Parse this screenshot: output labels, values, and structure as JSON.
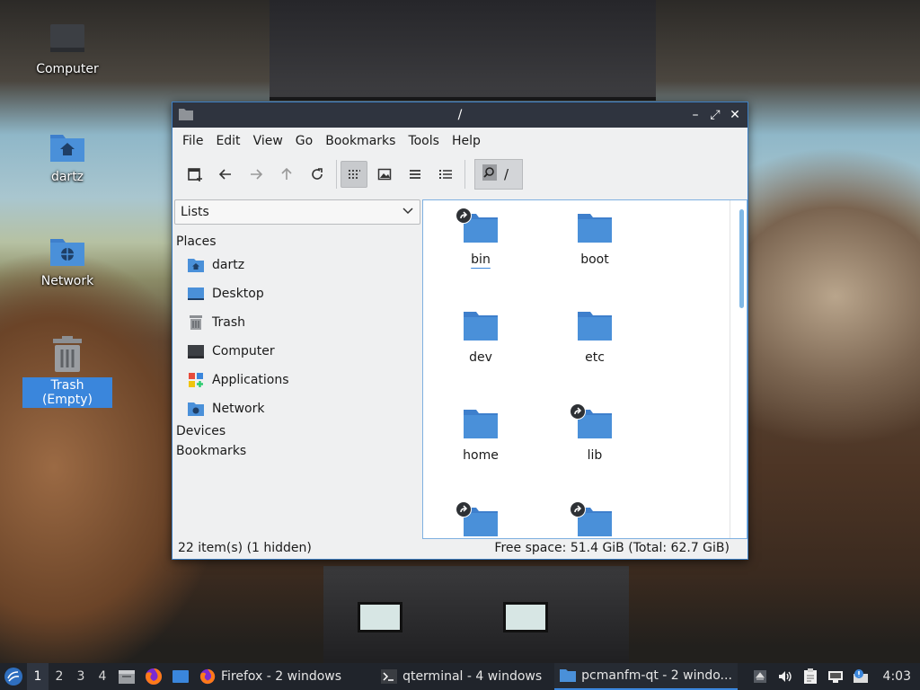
{
  "desktop": {
    "icons": [
      {
        "label": "Computer",
        "icon": "computer-icon"
      },
      {
        "label": "dartz",
        "icon": "home-folder-icon"
      },
      {
        "label": "Network",
        "icon": "network-folder-icon"
      },
      {
        "label": "Trash (Empty)",
        "icon": "trash-icon",
        "selected": true
      }
    ]
  },
  "window": {
    "title": "/",
    "buttons": {
      "minimize": "–",
      "maximize": "⤢",
      "close": "✕"
    },
    "menu": [
      "File",
      "Edit",
      "View",
      "Go",
      "Bookmarks",
      "Tools",
      "Help"
    ],
    "toolbar": {
      "buttons": [
        "new-tab-icon",
        "back-icon",
        "forward-icon",
        "up-icon",
        "reload-icon",
        "icon-view-icon",
        "thumbnail-view-icon",
        "compact-view-icon",
        "detailed-list-icon"
      ],
      "active_view": "icon-view-icon",
      "path": "/"
    },
    "sidebar": {
      "selector": "Lists",
      "sections": {
        "places": "Places",
        "devices": "Devices",
        "bookmarks": "Bookmarks"
      },
      "places": [
        {
          "label": "dartz",
          "icon": "home-folder-icon"
        },
        {
          "label": "Desktop",
          "icon": "desktop-icon"
        },
        {
          "label": "Trash",
          "icon": "trash-icon"
        },
        {
          "label": "Computer",
          "icon": "computer-icon"
        },
        {
          "label": "Applications",
          "icon": "applications-icon"
        },
        {
          "label": "Network",
          "icon": "network-folder-icon"
        }
      ]
    },
    "files": [
      {
        "name": "bin",
        "symlink": true,
        "focused": true
      },
      {
        "name": "boot",
        "symlink": false
      },
      {
        "name": "dev",
        "symlink": false
      },
      {
        "name": "etc",
        "symlink": false
      },
      {
        "name": "home",
        "symlink": false
      },
      {
        "name": "lib",
        "symlink": true
      },
      {
        "name": "",
        "symlink": true
      },
      {
        "name": "",
        "symlink": true
      }
    ],
    "status": {
      "left": "22 item(s) (1 hidden)",
      "right": "Free space: 51.4 GiB (Total: 62.7 GiB)"
    }
  },
  "taskbar": {
    "workspaces": [
      "1",
      "2",
      "3",
      "4"
    ],
    "current_workspace": "1",
    "quicklaunch": [
      "file-manager-icon",
      "firefox-icon",
      "show-desktop-icon"
    ],
    "tasks": [
      {
        "label": "Firefox - 2 windows",
        "icon": "firefox-icon"
      },
      {
        "label": "qterminal - 4 windows",
        "icon": "terminal-icon"
      },
      {
        "label": "pcmanfm-qt - 2 windo...",
        "icon": "folder-icon",
        "active": true
      }
    ],
    "tray": [
      "eject-icon",
      "volume-icon",
      "clipboard-icon",
      "network-icon",
      "update-notifier-icon"
    ],
    "clock": "4:03"
  },
  "colors": {
    "accent": "#3a86dc",
    "folder": "#4a90d9",
    "titlebar": "#2f343f",
    "taskbar": "#20242b"
  }
}
